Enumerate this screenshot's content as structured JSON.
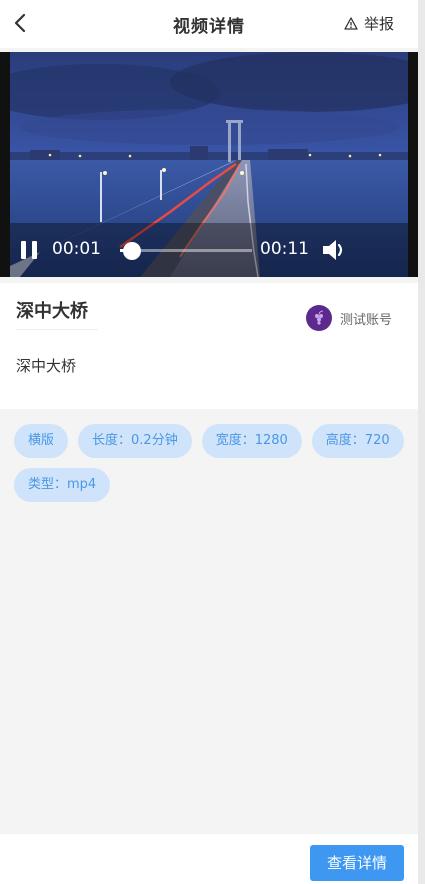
{
  "header": {
    "title": "视频详情",
    "report_label": "举报",
    "back_icon": "chevron-left-icon",
    "report_icon": "warning-triangle-icon"
  },
  "player": {
    "current_time": "00:01",
    "total_time": "00:11",
    "progress": 0.09,
    "state": "playing",
    "pause_icon": "pause-icon",
    "volume_icon": "volume-icon"
  },
  "video": {
    "name": "深中大桥",
    "description": "深中大桥"
  },
  "account": {
    "name": "测试账号",
    "avatar_color": "#5b2a8c"
  },
  "tags": [
    "横版",
    "长度：0.2分钟",
    "宽度：1280",
    "高度：720",
    "类型：mp4"
  ],
  "footer": {
    "detail_button": "查看详情"
  },
  "colors": {
    "accent": "#3e98f2",
    "tag_bg": "#cfe4fa",
    "tag_text": "#4a97e6",
    "page_bg": "#f4f4f4"
  }
}
